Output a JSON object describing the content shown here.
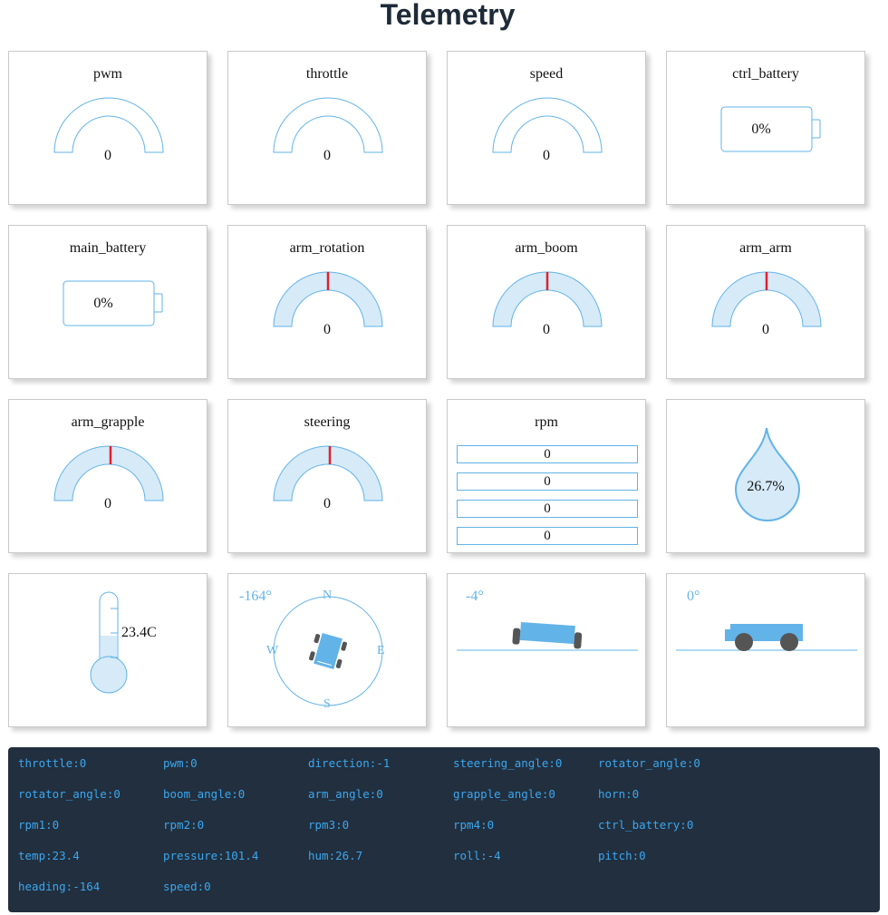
{
  "title": "Telemetry",
  "colors": {
    "accent": "#62b3e8",
    "fill": "#d6eaf8",
    "needle": "#e0202c",
    "console_bg": "#222f3e",
    "console_text": "#3aa7f0"
  },
  "gauges": {
    "pwm": {
      "label": "pwm",
      "value": "0"
    },
    "throttle": {
      "label": "throttle",
      "value": "0"
    },
    "speed": {
      "label": "speed",
      "value": "0"
    },
    "arm_rotation": {
      "label": "arm_rotation",
      "value": "0"
    },
    "arm_boom": {
      "label": "arm_boom",
      "value": "0"
    },
    "arm_arm": {
      "label": "arm_arm",
      "value": "0"
    },
    "arm_grapple": {
      "label": "arm_grapple",
      "value": "0"
    },
    "steering": {
      "label": "steering",
      "value": "0"
    }
  },
  "batteries": {
    "ctrl_battery": {
      "label": "ctrl_battery",
      "value": "0%"
    },
    "main_battery": {
      "label": "main_battery",
      "value": "0%"
    }
  },
  "rpm": {
    "label": "rpm",
    "values": [
      "0",
      "0",
      "0",
      "0"
    ]
  },
  "humidity": {
    "value": "26.7%"
  },
  "temperature": {
    "value": "23.4C"
  },
  "heading": {
    "value": "-164°",
    "north": "N",
    "south": "S",
    "east": "E",
    "west": "W"
  },
  "roll": {
    "value": "-4°"
  },
  "pitch": {
    "value": "0°"
  },
  "console": [
    [
      "throttle:0",
      "pwm:0",
      "direction:-1",
      "steering_angle:0",
      "rotator_angle:0"
    ],
    [
      "rotator_angle:0",
      "boom_angle:0",
      "arm_angle:0",
      "grapple_angle:0",
      "horn:0"
    ],
    [
      "rpm1:0",
      "rpm2:0",
      "rpm3:0",
      "rpm4:0",
      "ctrl_battery:0"
    ],
    [
      "temp:23.4",
      "pressure:101.4",
      "hum:26.7",
      "roll:-4",
      "pitch:0"
    ],
    [
      "heading:-164",
      "speed:0"
    ]
  ]
}
